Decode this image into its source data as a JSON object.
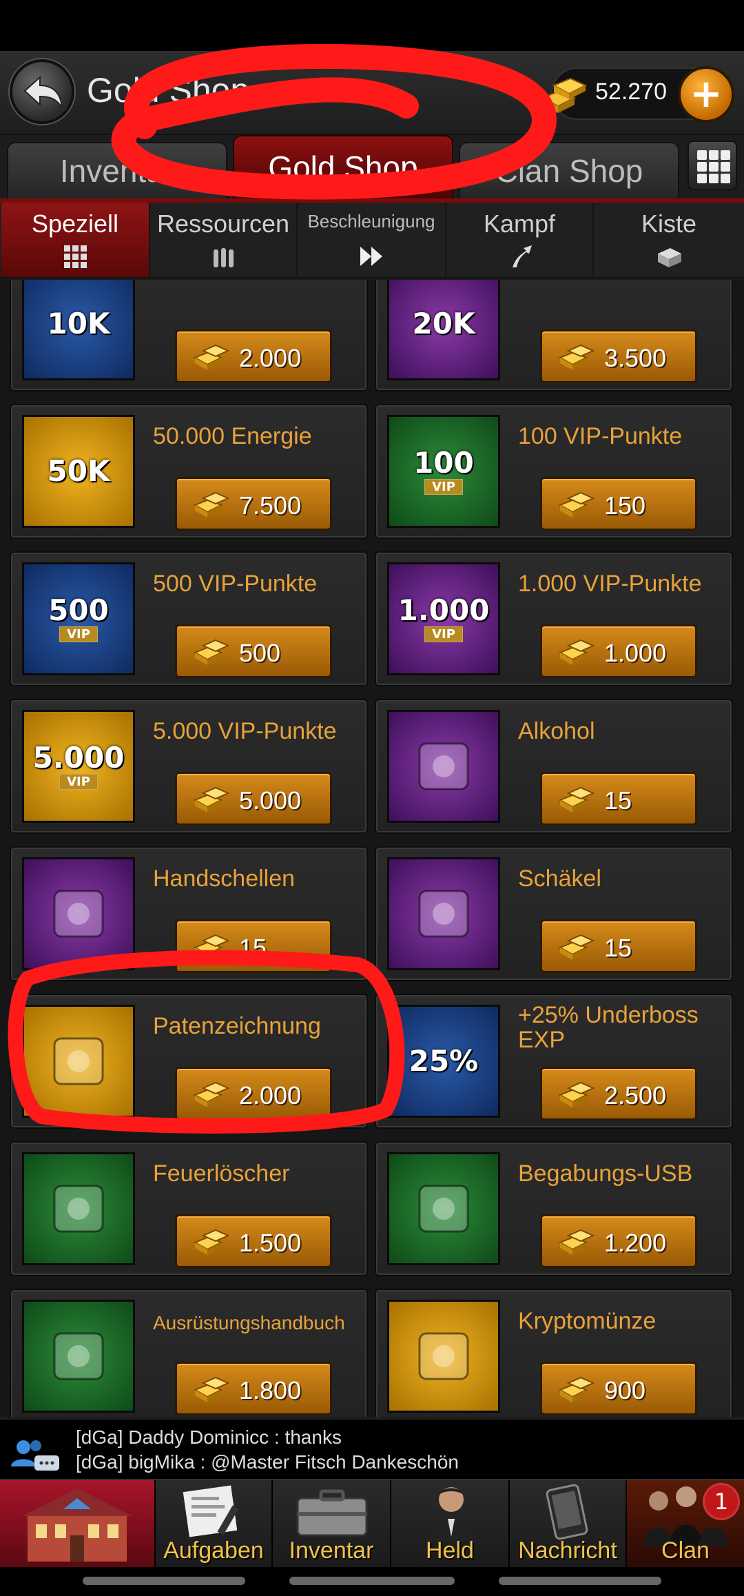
{
  "header": {
    "title": "Gold Shop",
    "gold_amount": "52.270",
    "plus_label": "+"
  },
  "main_tabs": [
    {
      "label": "Inventar"
    },
    {
      "label": "Gold Shop"
    },
    {
      "label": "Clan Shop"
    }
  ],
  "sub_tabs": [
    {
      "label": "Speziell"
    },
    {
      "label": "Ressourcen"
    },
    {
      "label": "Beschleunigung"
    },
    {
      "label": "Kampf"
    },
    {
      "label": "Kiste"
    }
  ],
  "items": [
    {
      "name": "",
      "thumb": "10K",
      "color": "blue",
      "price": "2.000"
    },
    {
      "name": "",
      "thumb": "20K",
      "color": "purple",
      "price": "3.500"
    },
    {
      "name": "50.000 Energie",
      "thumb": "50K",
      "color": "gold",
      "price": "7.500"
    },
    {
      "name": "100 VIP-Punkte",
      "thumb": "100",
      "color": "green",
      "price": "150"
    },
    {
      "name": "500 VIP-Punkte",
      "thumb": "500",
      "color": "blue",
      "price": "500"
    },
    {
      "name": "1.000 VIP-Punkte",
      "thumb": "1.000",
      "color": "purple",
      "price": "1.000"
    },
    {
      "name": "5.000 VIP-Punkte",
      "thumb": "5.000",
      "color": "gold",
      "price": "5.000"
    },
    {
      "name": "Alkohol",
      "thumb": "",
      "color": "purple",
      "price": "15"
    },
    {
      "name": "Handschellen",
      "thumb": "",
      "color": "purple",
      "price": "15"
    },
    {
      "name": "Schäkel",
      "thumb": "",
      "color": "purple",
      "price": "15"
    },
    {
      "name": "Patenzeichnung",
      "thumb": "",
      "color": "gold",
      "price": "2.000"
    },
    {
      "name": "+25% Underboss EXP",
      "thumb": "25%",
      "color": "blue",
      "price": "2.500"
    },
    {
      "name": "Feuerlöscher",
      "thumb": "",
      "color": "green",
      "price": "1.500"
    },
    {
      "name": "Begabungs-USB",
      "thumb": "",
      "color": "green",
      "price": "1.200"
    },
    {
      "name": "Ausrüstungshandbuch",
      "thumb": "",
      "color": "green",
      "price": "1.800"
    },
    {
      "name": "Kryptomünze",
      "thumb": "",
      "color": "gold",
      "price": "900"
    }
  ],
  "vip_label": "VIP",
  "chat": {
    "line1": "[dGa] Daddy Dominicc : thanks",
    "line2": "[dGa] bigMika : @Master Fitsch Dankeschön"
  },
  "nav": [
    {
      "label": ""
    },
    {
      "label": "Aufgaben"
    },
    {
      "label": "Inventar"
    },
    {
      "label": "Held"
    },
    {
      "label": "Nachricht"
    },
    {
      "label": "Clan",
      "badge": "1"
    }
  ],
  "colors": {
    "accent_red": "#8e1010",
    "gold_text": "#e8a23a",
    "annotation": "#ff1a1a"
  }
}
